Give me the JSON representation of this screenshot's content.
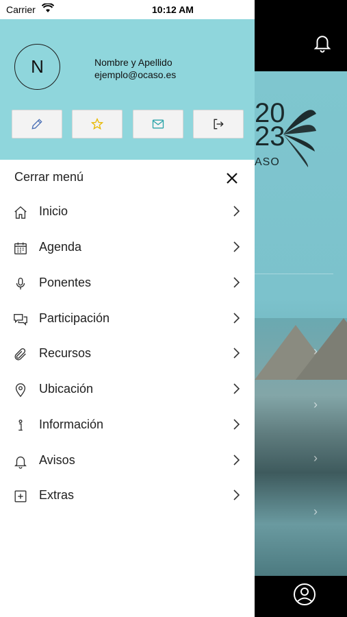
{
  "status_bar": {
    "carrier": "Carrier",
    "time": "10:12 AM"
  },
  "profile": {
    "avatar_initial": "N",
    "name": "Nombre y Apellido",
    "email": "ejemplo@ocaso.es"
  },
  "actions": [
    {
      "icon": "pencil-icon"
    },
    {
      "icon": "star-icon"
    },
    {
      "icon": "mail-icon"
    },
    {
      "icon": "logout-icon"
    }
  ],
  "close_menu": {
    "label": "Cerrar menú"
  },
  "menu": [
    {
      "label": "Inicio",
      "icon": "home-icon"
    },
    {
      "label": "Agenda",
      "icon": "calendar-icon"
    },
    {
      "label": "Ponentes",
      "icon": "microphone-icon"
    },
    {
      "label": "Participación",
      "icon": "chat-icon"
    },
    {
      "label": "Recursos",
      "icon": "paperclip-icon"
    },
    {
      "label": "Ubicación",
      "icon": "location-pin-icon"
    },
    {
      "label": "Información",
      "icon": "info-icon"
    },
    {
      "label": "Avisos",
      "icon": "bell-icon"
    },
    {
      "label": "Extras",
      "icon": "plus-square-icon"
    }
  ],
  "background": {
    "logo_line1": "20",
    "logo_line2": "23",
    "logo_sub": "ASO"
  },
  "colors": {
    "header": "#8fd6dc",
    "accent_star": "#e7b800",
    "accent_mail": "#2aa3a8",
    "accent_pencil": "#4a6fb5"
  }
}
